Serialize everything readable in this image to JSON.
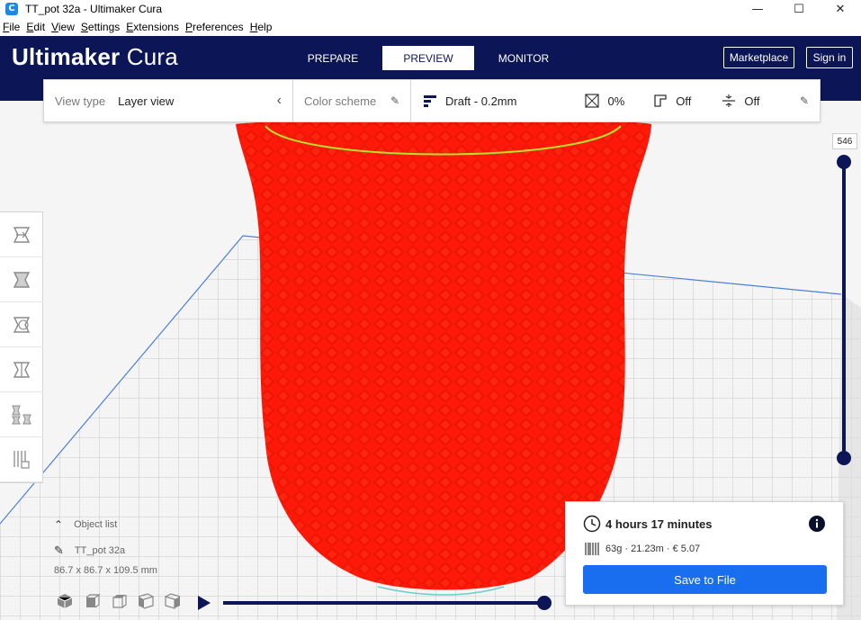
{
  "window": {
    "title": "TT_pot 32a - Ultimaker Cura",
    "controls": {
      "minimize": "—",
      "maximize": "☐",
      "close": "✕"
    }
  },
  "menu": [
    "File",
    "Edit",
    "View",
    "Settings",
    "Extensions",
    "Preferences",
    "Help"
  ],
  "header": {
    "logo_bold": "Ultimaker",
    "logo_light": "Cura",
    "tabs": [
      {
        "label": "PREPARE",
        "active": false
      },
      {
        "label": "PREVIEW",
        "active": true
      },
      {
        "label": "MONITOR",
        "active": false
      }
    ],
    "marketplace_label": "Marketplace",
    "signin_label": "Sign in",
    "background_color": "#0c1657"
  },
  "settings_bar": {
    "view_type_label": "View type",
    "view_type_value": "Layer view",
    "color_scheme_label": "Color scheme",
    "profile": "Draft - 0.2mm",
    "infill": "0%",
    "support": "Off",
    "adhesion": "Off"
  },
  "layer_slider": {
    "value": "546"
  },
  "object_info": {
    "list_label": "Object list",
    "object_name": "TT_pot 32a",
    "dimensions": "86.7 x 86.7 x 109.5 mm"
  },
  "print_info": {
    "time": "4 hours 17 minutes",
    "material": "63g · 21.23m · € 5.07",
    "save_label": "Save to File",
    "accent_color": "#196ef0"
  },
  "model_color": "#ff1a0a"
}
